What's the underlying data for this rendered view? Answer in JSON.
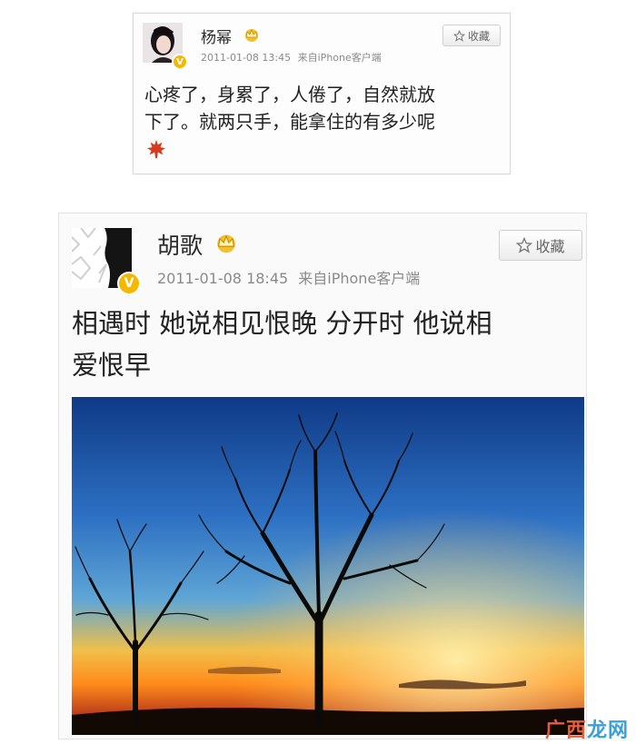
{
  "post1": {
    "username": "杨幂",
    "verified_badge": "V",
    "timestamp": "2011-01-08 13:45",
    "source": "来自iPhone客户端",
    "favorite_label": "收藏",
    "content_line1": "心疼了，身累了，人倦了，自然就放",
    "content_line2": "下了。就两只手，能拿住的有多少呢",
    "icons": {
      "crown": "crown-icon",
      "star": "star-outline-icon",
      "emoji": "maple-leaf-icon"
    }
  },
  "post2": {
    "username": "胡歌",
    "verified_badge": "V",
    "timestamp": "2011-01-08 18:45",
    "source": "来自iPhone客户端",
    "favorite_label": "收藏",
    "content_line1": "相遇时 她说相见恨晚 分开时 他说相",
    "content_line2": "爱恨早",
    "icons": {
      "crown": "crown-icon",
      "star": "star-outline-icon"
    },
    "photo": {
      "description_type": "sunset-trees-image"
    }
  },
  "watermark": {
    "part1": "广西",
    "part2": "龙网"
  },
  "colors": {
    "badge": "#f5b800",
    "meta": "#8a8a8a",
    "emoji": "#d83a1e",
    "sky_top": "#1d4fa0",
    "sunset": "#ff8c1a"
  }
}
